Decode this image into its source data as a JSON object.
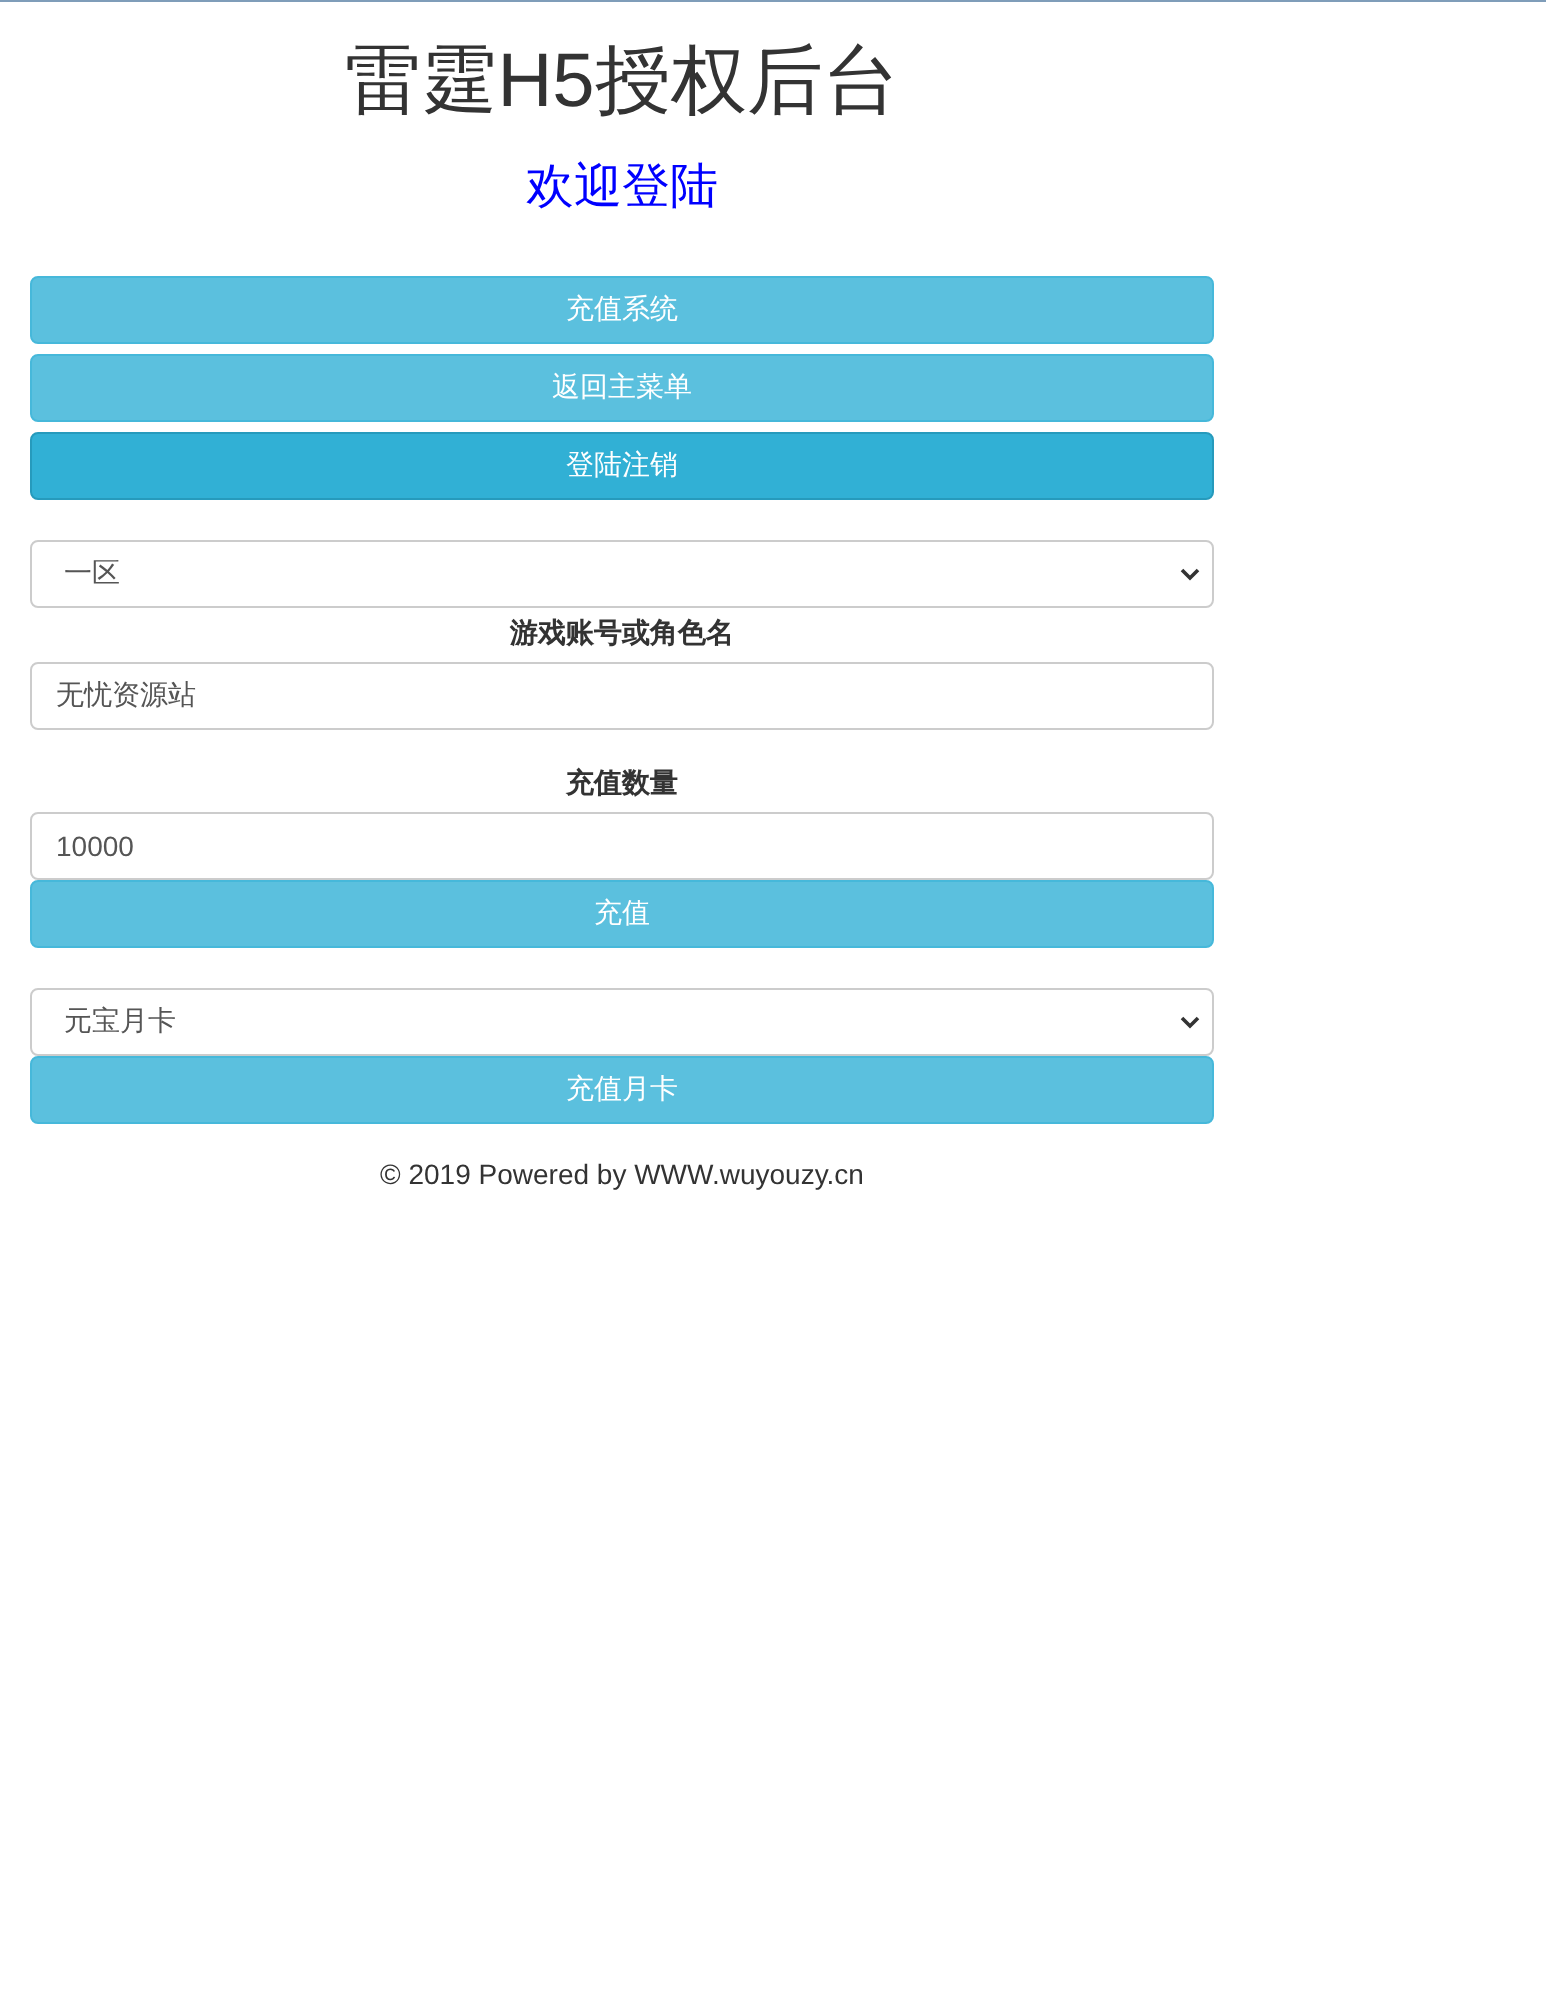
{
  "title": "雷霆H5授权后台",
  "subtitle": "欢迎登陆",
  "nav_buttons": [
    {
      "label": "充值系统",
      "active": false
    },
    {
      "label": "返回主菜单",
      "active": false
    },
    {
      "label": "登陆注销",
      "active": true
    }
  ],
  "server_select": {
    "value": "一区"
  },
  "account_field": {
    "label": "游戏账号或角色名",
    "value": "无忧资源站"
  },
  "amount_field": {
    "label": "充值数量",
    "value": "10000"
  },
  "recharge_button": {
    "label": "充值"
  },
  "card_select": {
    "value": "元宝月卡"
  },
  "card_button": {
    "label": "充值月卡"
  },
  "footer": "© 2019 Powered by WWW.wuyouzy.cn"
}
